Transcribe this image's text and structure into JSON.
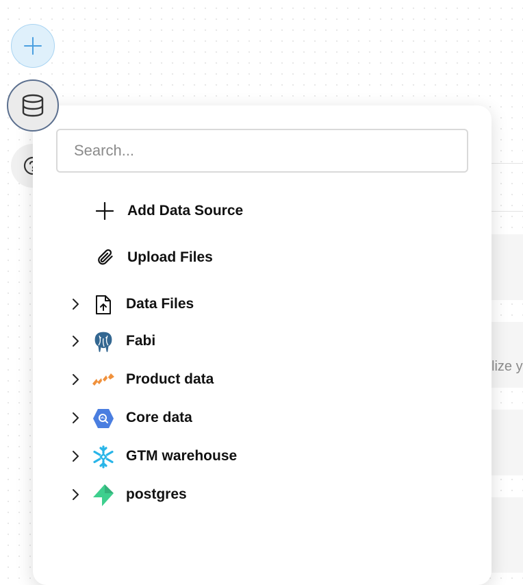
{
  "rail": {
    "add": {
      "icon": "plus-icon"
    },
    "data": {
      "icon": "database-icon"
    },
    "help": {
      "icon": "help-circle-icon"
    }
  },
  "background": {
    "partial_text": "lize y"
  },
  "panel": {
    "search": {
      "placeholder": "Search...",
      "value": ""
    },
    "actions": [
      {
        "label": "Add Data Source",
        "icon": "plus-icon"
      },
      {
        "label": "Upload Files",
        "icon": "paperclip-icon"
      }
    ],
    "sources": [
      {
        "label": "Data Files",
        "icon": "file-upload-icon"
      },
      {
        "label": "Fabi",
        "icon": "postgresql-elephant-icon"
      },
      {
        "label": "Product data",
        "icon": "clickhouse-icon"
      },
      {
        "label": "Core data",
        "icon": "bigquery-icon"
      },
      {
        "label": "GTM warehouse",
        "icon": "snowflake-icon"
      },
      {
        "label": "postgres",
        "icon": "supabase-bolt-icon"
      }
    ]
  },
  "colors": {
    "accent_blue": "#4a9fe0",
    "bigquery_blue": "#4a7ee0",
    "snowflake_cyan": "#29b5e8",
    "supabase_green": "#3ecf8e",
    "clickhouse_orange": "#f0913c"
  }
}
